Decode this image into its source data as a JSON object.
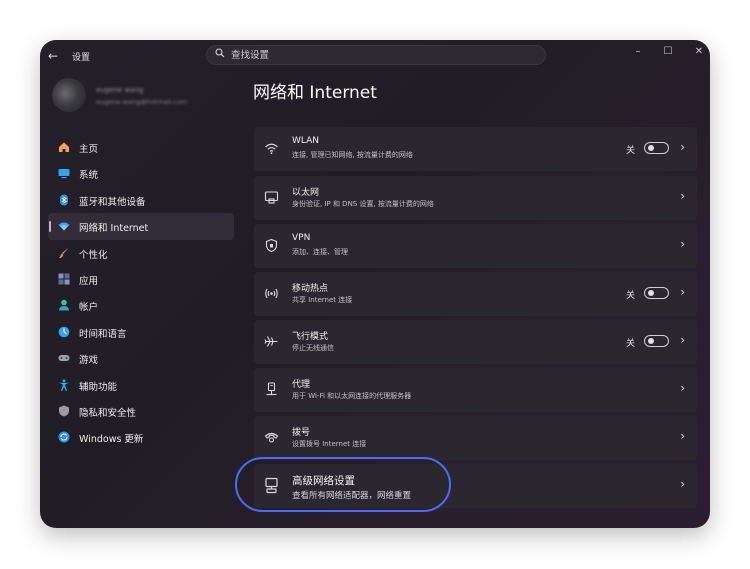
{
  "window": {
    "title": "设置",
    "back_label": "←",
    "controls": {
      "minimize": "–",
      "maximize": "☐",
      "close": "✕"
    }
  },
  "search": {
    "placeholder": "查找设置"
  },
  "user": {
    "name": "eugene wang",
    "email": "eugene.wang@hotmail.com"
  },
  "nav": {
    "items": [
      {
        "label": "主页",
        "icon": "home-icon",
        "color": "#f0a35e"
      },
      {
        "label": "系统",
        "icon": "system-icon",
        "color": "#3aa0e8"
      },
      {
        "label": "蓝牙和其他设备",
        "icon": "bluetooth-icon",
        "color": "#2f8fe8"
      },
      {
        "label": "网络和 Internet",
        "icon": "network-icon",
        "color": "#3ba8f0",
        "active": true
      },
      {
        "label": "个性化",
        "icon": "brush-icon",
        "color": "#e8a070"
      },
      {
        "label": "应用",
        "icon": "apps-icon",
        "color": "#8a96b8"
      },
      {
        "label": "帐户",
        "icon": "account-icon",
        "color": "#3cc2a0"
      },
      {
        "label": "时间和语言",
        "icon": "time-language-icon",
        "color": "#3aa0e8"
      },
      {
        "label": "游戏",
        "icon": "gaming-icon",
        "color": "#9aa0aa"
      },
      {
        "label": "辅助功能",
        "icon": "accessibility-icon",
        "color": "#3aa8f0"
      },
      {
        "label": "隐私和安全性",
        "icon": "shield-icon",
        "color": "#9a9aa6"
      },
      {
        "label": "Windows 更新",
        "icon": "update-icon",
        "color": "#2f8fe8"
      }
    ]
  },
  "page": {
    "title": "网络和 Internet"
  },
  "settings": [
    {
      "title": "WLAN",
      "desc": "连接, 管理已知网络, 按流量计费的网络",
      "icon": "wifi-icon",
      "toggle": {
        "state_label": "关",
        "on": false
      }
    },
    {
      "title": "以太网",
      "desc": "身份验证, IP 和 DNS 设置, 按流量计费的网络",
      "icon": "ethernet-icon"
    },
    {
      "title": "VPN",
      "desc": "添加、连接、管理",
      "icon": "vpn-shield-icon"
    },
    {
      "title": "移动热点",
      "desc": "共享 Internet 连接",
      "icon": "hotspot-icon",
      "toggle": {
        "state_label": "关",
        "on": false
      }
    },
    {
      "title": "飞行模式",
      "desc": "停止无线通信",
      "icon": "airplane-icon",
      "toggle": {
        "state_label": "关",
        "on": false
      }
    },
    {
      "title": "代理",
      "desc": "用于 Wi-Fi 和以太网连接的代理服务器",
      "icon": "proxy-icon"
    },
    {
      "title": "拨号",
      "desc": "设置拨号 Internet 连接",
      "icon": "dialup-icon"
    },
    {
      "title": "高级网络设置",
      "desc": "查看所有网络适配器，网络重置",
      "icon": "advanced-network-icon"
    }
  ],
  "chevron": "›",
  "highlight_color": "#4a6cf7"
}
